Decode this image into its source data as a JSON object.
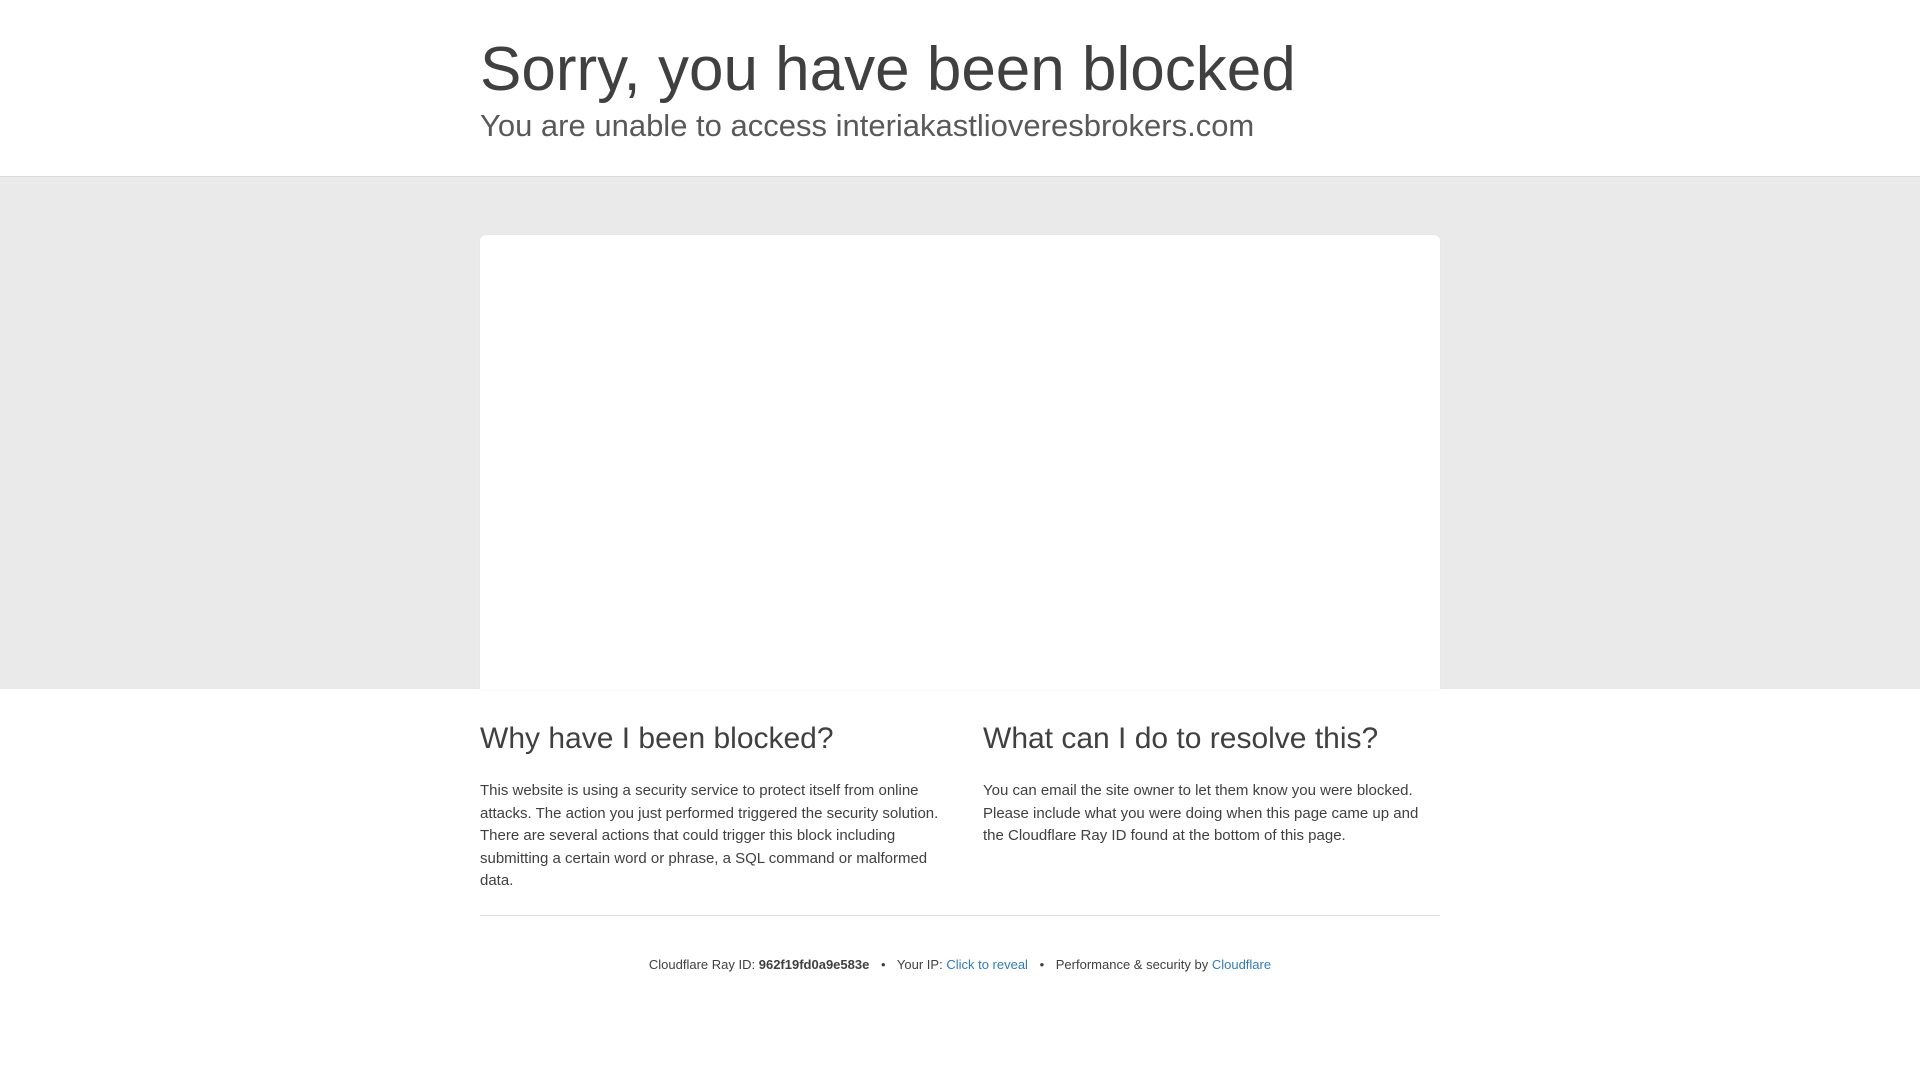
{
  "header": {
    "title": "Sorry, you have been blocked",
    "subtitle": "You are unable to access interiakastlioveresbrokers.com"
  },
  "why": {
    "heading": "Why have I been blocked?",
    "body": "This website is using a security service to protect itself from online attacks. The action you just performed triggered the security solution. There are several actions that could trigger this block including submitting a certain word or phrase, a SQL command or malformed data."
  },
  "resolve": {
    "heading": "What can I do to resolve this?",
    "body": "You can email the site owner to let them know you were blocked. Please include what you were doing when this page came up and the Cloudflare Ray ID found at the bottom of this page."
  },
  "footer": {
    "ray_label": "Cloudflare Ray ID:",
    "ray_id": "962f19fd0a9e583e",
    "separator": "•",
    "ip_label": "Your IP:",
    "ip_link": "Click to reveal",
    "perf_label": "Performance & security by",
    "cloudflare_link": "Cloudflare"
  },
  "colors": {
    "link": "#2f7bbf",
    "band": "#eaeaea",
    "text": "#404040"
  }
}
